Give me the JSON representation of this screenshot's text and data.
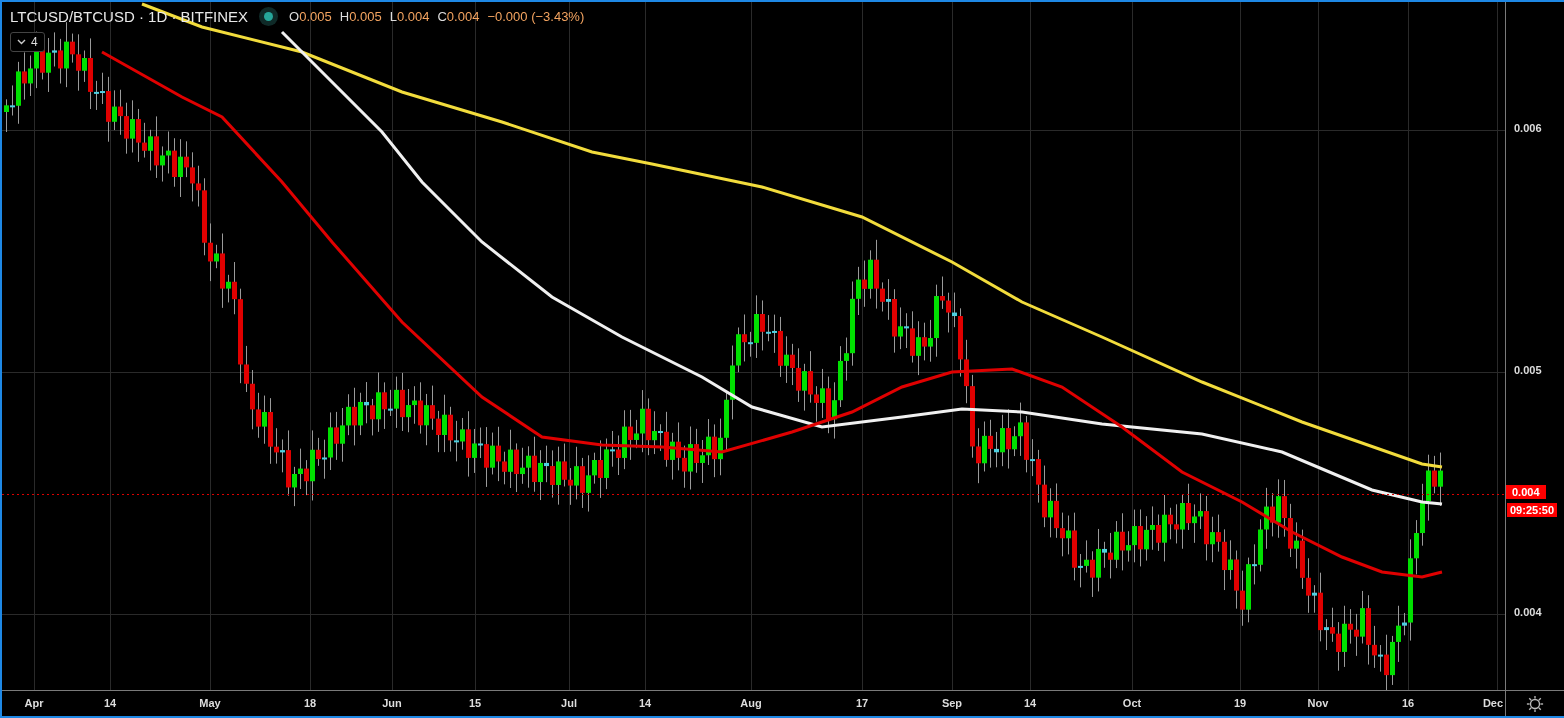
{
  "legend": {
    "title": "LTCUSD/BTCUSD · 1D · BITFINEX",
    "ohlc": [
      {
        "label": "O",
        "value": "0.005"
      },
      {
        "label": "H",
        "value": "0.005"
      },
      {
        "label": "L",
        "value": "0.004"
      },
      {
        "label": "C",
        "value": "0.004"
      }
    ],
    "change": "−0.000 (−3.43%)"
  },
  "indicators_toggle": {
    "count": "4"
  },
  "price_axis": {
    "ticks": [
      "0.006",
      "0.005",
      "0.004"
    ]
  },
  "current_price": {
    "price": "0.004",
    "countdown": "09:25:50"
  },
  "time_axis": {
    "labels": [
      "Apr",
      "14",
      "May",
      "18",
      "Jun",
      "15",
      "Jul",
      "14",
      "Aug",
      "17",
      "Sep",
      "14",
      "Oct",
      "19",
      "Nov",
      "16",
      "Dec"
    ]
  }
}
